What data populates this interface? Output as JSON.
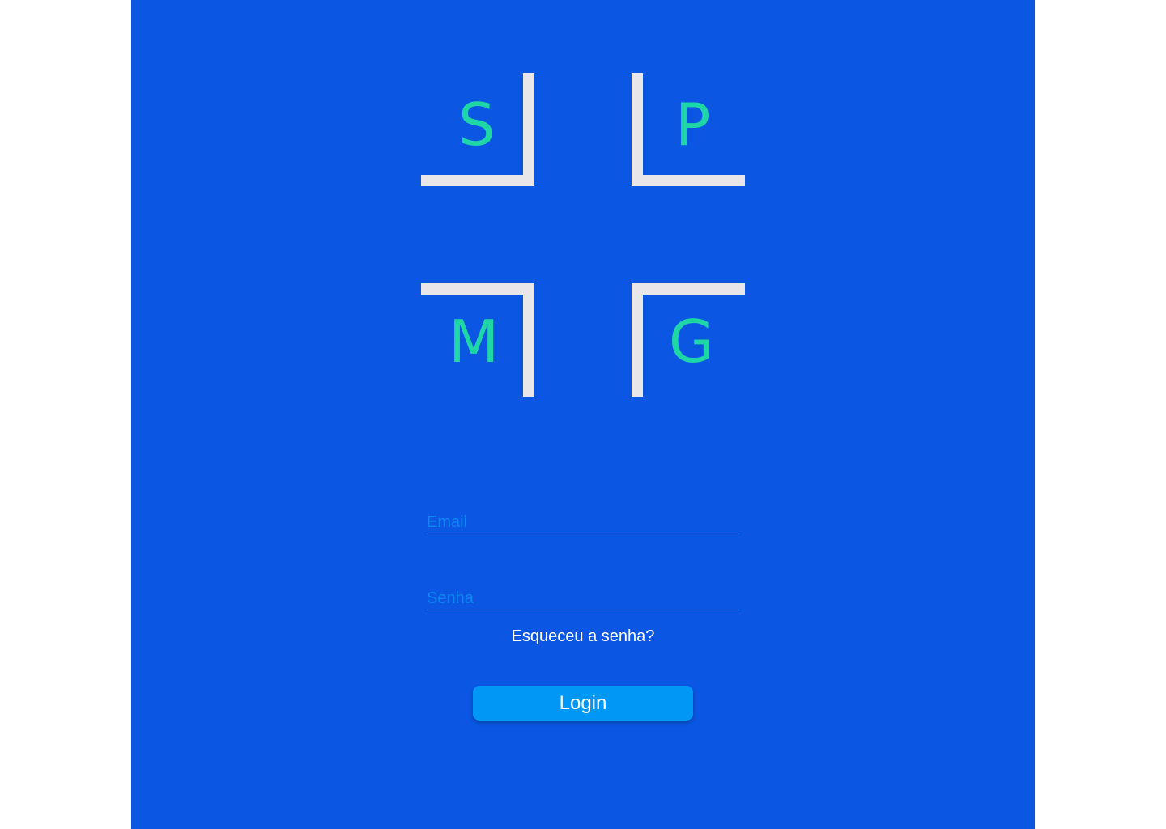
{
  "logo": {
    "letters": {
      "top_left": "S",
      "top_right": "P",
      "bottom_left": "M",
      "bottom_right": "G"
    }
  },
  "form": {
    "email_placeholder": "Email",
    "password_placeholder": "Senha",
    "forgot_password_label": "Esqueceu a senha?",
    "login_label": "Login"
  },
  "colors": {
    "background": "#0b57e4",
    "letters": "#1ed6a6",
    "brackets": "#e8e6e8",
    "button": "#0198f5",
    "input_underline": "#0b8ef5"
  }
}
